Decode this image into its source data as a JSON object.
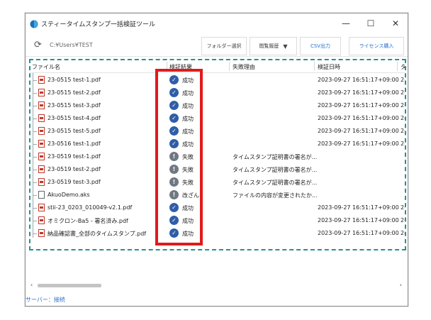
{
  "window": {
    "title": "スティータイムスタンプ一括検証ツール",
    "controls": {
      "minimize": "—",
      "maximize": "☐",
      "close": "✕"
    }
  },
  "toolbar": {
    "path": "C:¥Users¥TEST",
    "buttons": {
      "folder_select": "フォルダー選択",
      "history": "閲覧履歴",
      "csv": "CSV出力",
      "license": "ライセンス購入"
    }
  },
  "table": {
    "headers": [
      "ファイル名",
      "検証結果",
      "失敗理由",
      "検証日時",
      "タ"
    ],
    "rows": [
      {
        "file": "23-0515 test-1.pdf",
        "icon": "pdf-icon",
        "status": "成功",
        "status_kind": "ok",
        "reason": "",
        "date": "2023-09-27 16:51:17+09:00",
        "extra": "2("
      },
      {
        "file": "23-0515 test-2.pdf",
        "icon": "pdf-icon",
        "status": "成功",
        "status_kind": "ok",
        "reason": "",
        "date": "2023-09-27 16:51:17+09:00",
        "extra": "2("
      },
      {
        "file": "23-0515 test-3.pdf",
        "icon": "pdf-icon",
        "status": "成功",
        "status_kind": "ok",
        "reason": "",
        "date": "2023-09-27 16:51:17+09:00",
        "extra": "2("
      },
      {
        "file": "23-0515 test-4.pdf",
        "icon": "pdf-icon",
        "status": "成功",
        "status_kind": "ok",
        "reason": "",
        "date": "2023-09-27 16:51:17+09:00",
        "extra": "2("
      },
      {
        "file": "23-0515 test-5.pdf",
        "icon": "pdf-icon",
        "status": "成功",
        "status_kind": "ok",
        "reason": "",
        "date": "2023-09-27 16:51:17+09:00",
        "extra": "2("
      },
      {
        "file": "23-0516 test-1.pdf",
        "icon": "pdf-icon",
        "status": "成功",
        "status_kind": "ok",
        "reason": "",
        "date": "2023-09-27 16:51:17+09:00",
        "extra": "2("
      },
      {
        "file": "23-0519 test-1.pdf",
        "icon": "pdf-icon",
        "status": "失敗",
        "status_kind": "ng",
        "reason": "タイムスタンプ証明書の署名が...",
        "date": "",
        "extra": ""
      },
      {
        "file": "23-0519 test-2.pdf",
        "icon": "pdf-icon",
        "status": "失敗",
        "status_kind": "ng",
        "reason": "タイムスタンプ証明書の署名が...",
        "date": "",
        "extra": ""
      },
      {
        "file": "23-0519 test-3.pdf",
        "icon": "pdf-icon",
        "status": "失敗",
        "status_kind": "ng",
        "reason": "タイムスタンプ証明書の署名が...",
        "date": "",
        "extra": ""
      },
      {
        "file": "AkuoDemo.aks",
        "icon": "file-icon",
        "status": "改ざん",
        "status_kind": "ng",
        "reason": "ファイルの内容が変更されたか...",
        "date": "",
        "extra": ""
      },
      {
        "file": "stii-23_0203_010049-v2.1.pdf",
        "icon": "pdf-icon",
        "status": "成功",
        "status_kind": "ok",
        "reason": "",
        "date": "2023-09-27 16:51:17+09:00",
        "extra": "2("
      },
      {
        "file": "オミクロン-Ba5 - 署名済み.pdf",
        "icon": "pdf-icon",
        "status": "成功",
        "status_kind": "ok",
        "reason": "",
        "date": "2023-09-27 16:51:17+09:00",
        "extra": "2("
      },
      {
        "file": "納品確認書_全部のタイムスタンプ.pdf",
        "icon": "pdf-icon",
        "status": "成功",
        "status_kind": "ok",
        "reason": "",
        "date": "2023-09-27 16:51:17+09:00",
        "extra": "2("
      }
    ]
  },
  "status_icons": {
    "ok": "✓",
    "ng": "!"
  },
  "scroll": {
    "left": "‹",
    "right": "›"
  },
  "statusbar": {
    "text": "サーバー：接続"
  },
  "colors": {
    "accent": "#2a6fc9",
    "ok": "#2f5ea8",
    "ng": "#707883",
    "highlight": "#e01b1b",
    "dashed": "#2a8f8f"
  }
}
